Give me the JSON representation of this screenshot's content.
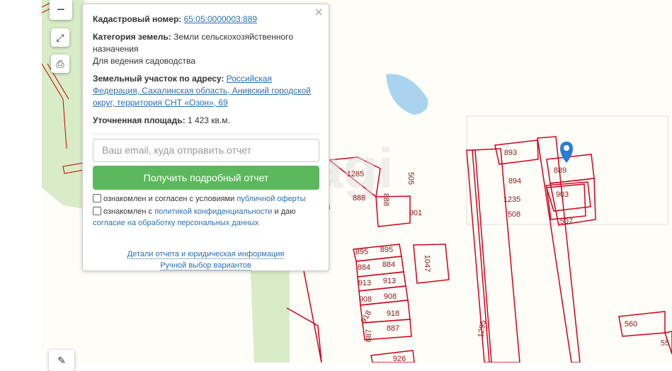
{
  "map": {
    "parcels": [
      "1285",
      "888",
      "888",
      "505",
      "901",
      "895",
      "895",
      "884",
      "884",
      "913",
      "913",
      "908",
      "908",
      "918",
      "918",
      "887",
      "887",
      "926",
      "1047",
      "1295",
      "893",
      "889",
      "894",
      "1235",
      "903",
      "508",
      "507",
      "560",
      "55"
    ],
    "watermark": "etagi"
  },
  "controls": {
    "zoom_out": "−",
    "fullscreen_icon": "expand-icon",
    "print_icon": "printer-icon",
    "ruler_icon": "ruler-icon"
  },
  "popup": {
    "close": "×",
    "cadastral_label": "Кадастровый номер:",
    "cadastral_value": "65:05:0000003:889",
    "category_label": "Категория земель:",
    "category_value": "Земли сельскохозяйственного назначения",
    "usage": "Для ведения садоводства",
    "address_label": "Земельный участок по адресу:",
    "address_value": "Российская Федерация, Сахалинская область, Анивский городской округ, территория СНТ «Озон», 69",
    "area_label": "Уточненная площадь:",
    "area_value": "1 423 кв.м.",
    "email_placeholder": "Ваш email, куда отправить отчет",
    "submit": "Получить подробный отчет",
    "agree1_text": "ознакомлен и согласен с условиями",
    "agree1_link": "публичной оферты",
    "agree2_text": "ознакомлен с",
    "agree2_link": "политикой конфиденциальности",
    "agree2_mid": "и даю",
    "agree2_link2": "согласие на обработку персональных данных",
    "details_link": "Детали отчета и юридическая информация",
    "manual_link": "Ручной выбор вариантов"
  },
  "colors": {
    "parcel": "#d0021b",
    "button": "#5cb85c",
    "link": "#2a6fb0",
    "marker": "#2b7cd3"
  }
}
